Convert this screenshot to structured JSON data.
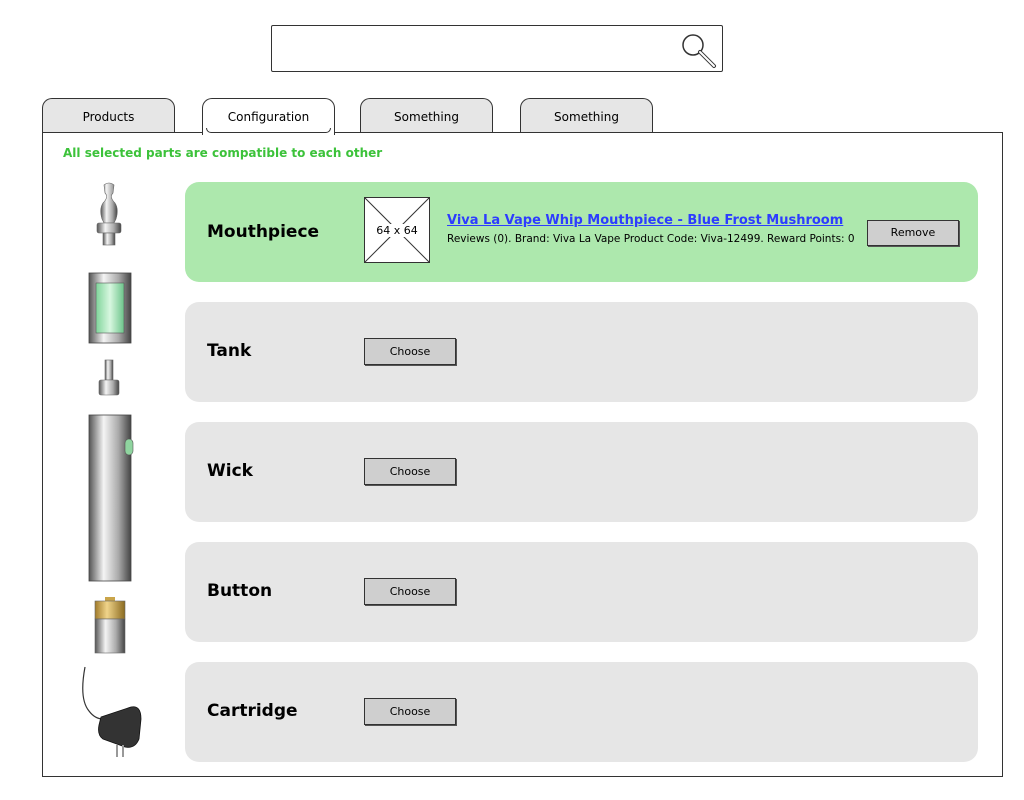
{
  "search": {
    "value": "",
    "placeholder": "",
    "icon": "search-icon"
  },
  "tabs": [
    {
      "label": "Products",
      "active": false
    },
    {
      "label": "Configuration",
      "active": true
    },
    {
      "label": "Something",
      "active": false
    },
    {
      "label": "Something",
      "active": false
    }
  ],
  "notice": {
    "text": "All selected parts are compatible to each other",
    "color": "#3cc23a"
  },
  "parts": [
    {
      "label": "Mouthpiece",
      "selected": true,
      "thumbnail_label": "64 x 64",
      "product_name": "Viva La Vape Whip Mouthpiece - Blue Frost Mushroom",
      "product_meta": "Reviews (0). Brand: Viva La Vape Product Code: Viva-12499. Reward Points: 0",
      "action_label": "Remove"
    },
    {
      "label": "Tank",
      "selected": false,
      "action_label": "Choose"
    },
    {
      "label": "Wick",
      "selected": false,
      "action_label": "Choose"
    },
    {
      "label": "Button",
      "selected": false,
      "action_label": "Choose"
    },
    {
      "label": "Cartridge",
      "selected": false,
      "action_label": "Choose"
    }
  ],
  "colors": {
    "selected_row": "#ade8ad",
    "row": "#e6e6e6",
    "link": "#2d3cff"
  }
}
